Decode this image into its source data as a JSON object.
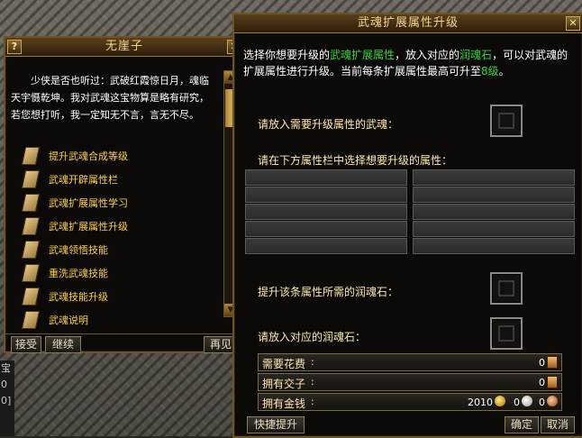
{
  "scene": {
    "hud_glyphs": [
      "宝",
      "0",
      "0]"
    ]
  },
  "npc_window": {
    "help_glyph": "?",
    "title": "无崖子",
    "close_glyph": "✕",
    "dialog": "少侠是否也听过：武破红霞惊日月，魂临天宇慑乾坤。我对武魂这宝物算是略有研究，若您想打听，我一定知无不言，言无不尽。",
    "options": [
      {
        "label": "提升武魂合成等级"
      },
      {
        "label": "武魂开辟属性栏"
      },
      {
        "label": "武魂扩展属性学习"
      },
      {
        "label": "武魂扩展属性升级"
      },
      {
        "label": "武魂领悟技能"
      },
      {
        "label": "重洗武魂技能"
      },
      {
        "label": "武魂技能升级"
      },
      {
        "label": "武魂说明"
      }
    ],
    "buttons": {
      "accept": "接受",
      "continue": "继续",
      "goodbye": "再见"
    }
  },
  "upgrade_window": {
    "title": "武魂扩展属性升级",
    "close_glyph": "✕",
    "description": {
      "p1": "选择你想要升级的",
      "hl1": "武魂扩展属性",
      "p2": "，放入对应的",
      "hl2": "润魂石",
      "p3": "，可以对武魂的扩展属性进行升级。当前每条扩展属性最高可升至",
      "level": "8级",
      "p4": "。"
    },
    "labels": {
      "put_soul": "请放入需要升级属性的武魂：",
      "select_attr": "请在下方属性栏中选择想要升级的属性：",
      "needed_stone": "提升该条属性所需的润魂石：",
      "put_stone": "请放入对应的润魂石："
    },
    "stats": {
      "cost_label": "需要花费",
      "cost_value": "0",
      "jiaozi_label": "拥有交子",
      "jiaozi_value": "0",
      "money_label": "拥有金钱",
      "gold": "2010",
      "silver": "0",
      "copper": "0"
    },
    "buttons": {
      "quick_upgrade": "快捷提升",
      "confirm": "确定",
      "cancel": "取消"
    }
  }
}
